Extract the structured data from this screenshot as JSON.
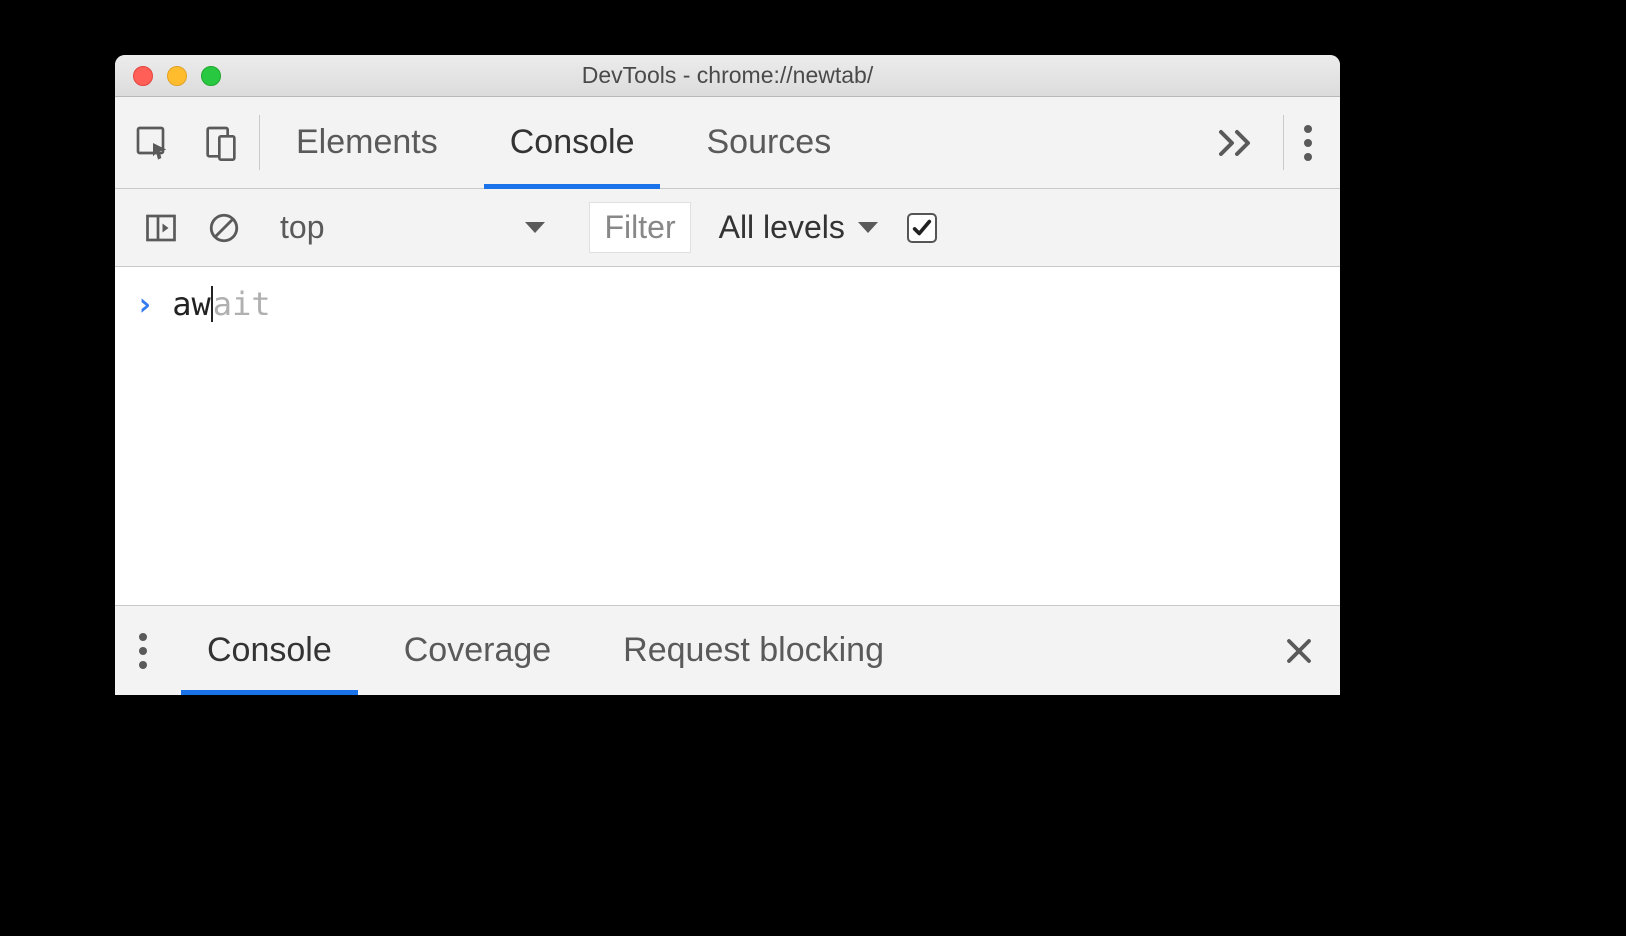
{
  "titlebar": {
    "title": "DevTools - chrome://newtab/"
  },
  "tabs": {
    "elements": "Elements",
    "console": "Console",
    "sources": "Sources"
  },
  "console_toolbar": {
    "context": "top",
    "filter_placeholder": "Filter",
    "levels": "All levels"
  },
  "console": {
    "typed": "aw",
    "suggestion": "ait"
  },
  "drawer": {
    "console": "Console",
    "coverage": "Coverage",
    "request_blocking": "Request blocking"
  }
}
